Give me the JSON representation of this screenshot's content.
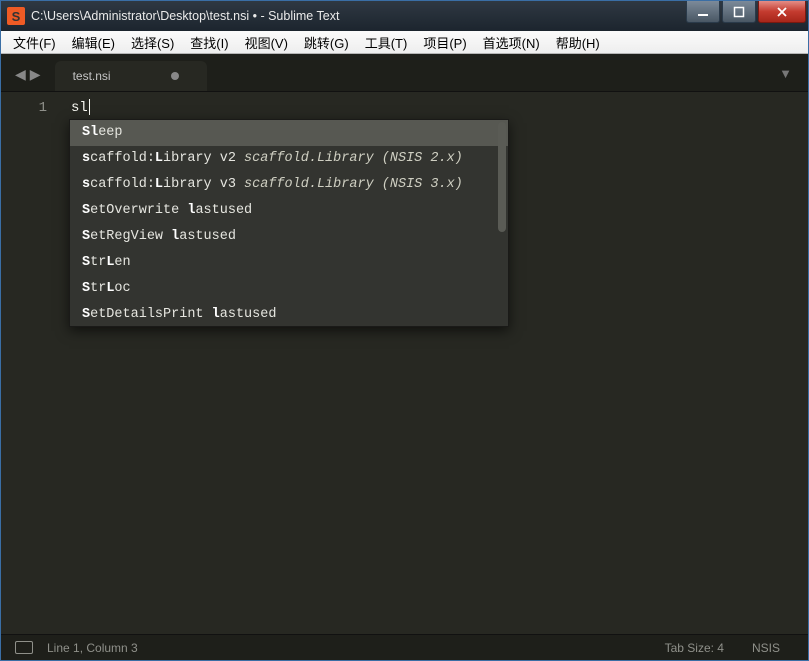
{
  "window": {
    "title": "C:\\Users\\Administrator\\Desktop\\test.nsi • - Sublime Text",
    "app_icon_letter": "S"
  },
  "menu": [
    "文件(F)",
    "编辑(E)",
    "选择(S)",
    "查找(I)",
    "视图(V)",
    "跳转(G)",
    "工具(T)",
    "项目(P)",
    "首选项(N)",
    "帮助(H)"
  ],
  "tab": {
    "label": "test.nsi",
    "dirty": true
  },
  "editor": {
    "line_numbers": [
      "1"
    ],
    "typed_text": "sl"
  },
  "autocomplete": {
    "selected_index": 0,
    "items": [
      {
        "match_html": "<b>Sl</b>eep",
        "hint": ""
      },
      {
        "match_html": "<b>s</b>caffold:<b>L</b>ibrary v2",
        "hint": "scaffold.Library (NSIS 2.x)"
      },
      {
        "match_html": "<b>s</b>caffold:<b>L</b>ibrary v3",
        "hint": "scaffold.Library (NSIS 3.x)"
      },
      {
        "match_html": "<b>S</b>etOverwrite <b>l</b>astused",
        "hint": ""
      },
      {
        "match_html": "<b>S</b>etRegView <b>l</b>astused",
        "hint": ""
      },
      {
        "match_html": "<b>S</b>tr<b>L</b>en",
        "hint": ""
      },
      {
        "match_html": "<b>S</b>tr<b>L</b>oc",
        "hint": ""
      },
      {
        "match_html": "<b>S</b>etDetailsPrint <b>l</b>astused",
        "hint": ""
      }
    ]
  },
  "statusbar": {
    "position": "Line 1, Column 3",
    "tab_size": "Tab Size: 4",
    "syntax": "NSIS"
  }
}
